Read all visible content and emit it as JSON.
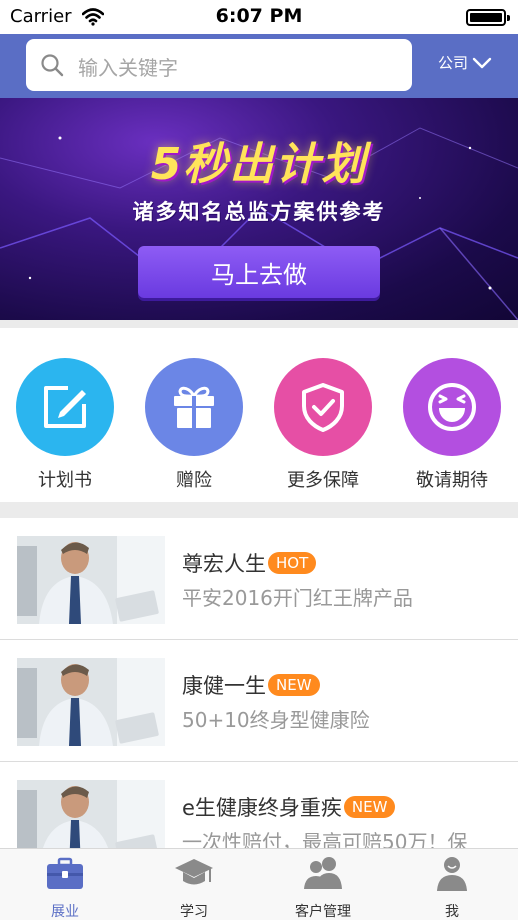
{
  "status_bar": {
    "carrier": "Carrier",
    "time": "6:07 PM"
  },
  "header": {
    "search_placeholder": "输入关键字",
    "company_label": "公司"
  },
  "banner": {
    "title": "5秒出计划",
    "subtitle": "诸多知名总监方案供参考",
    "button_label": "马上去做"
  },
  "categories": [
    {
      "label": "计划书",
      "color": "#2bb5ef",
      "icon": "edit-icon"
    },
    {
      "label": "赠险",
      "color": "#6b86e6",
      "icon": "gift-icon"
    },
    {
      "label": "更多保障",
      "color": "#e64fa5",
      "icon": "shield-check-icon"
    },
    {
      "label": "敬请期待",
      "color": "#b34fe0",
      "icon": "smile-icon"
    }
  ],
  "products": [
    {
      "title": "尊宏人生",
      "badge": "HOT",
      "desc": "平安2016开门红王牌产品"
    },
    {
      "title": "康健一生",
      "badge": "NEW",
      "desc": "50+10终身型健康险"
    },
    {
      "title": "e生健康终身重疾",
      "badge": "NEW",
      "desc": "一次性赔付，最高可赔50万！保"
    }
  ],
  "tabs": [
    {
      "label": "展业",
      "icon": "briefcase-icon",
      "active": true
    },
    {
      "label": "学习",
      "icon": "graduation-cap-icon",
      "active": false
    },
    {
      "label": "客户管理",
      "icon": "users-icon",
      "active": false
    },
    {
      "label": "我",
      "icon": "person-icon",
      "active": false
    }
  ],
  "colors": {
    "accent": "#5a6ec5",
    "badge": "#ff8a1e",
    "inactive_icon": "#8a8a8a"
  }
}
